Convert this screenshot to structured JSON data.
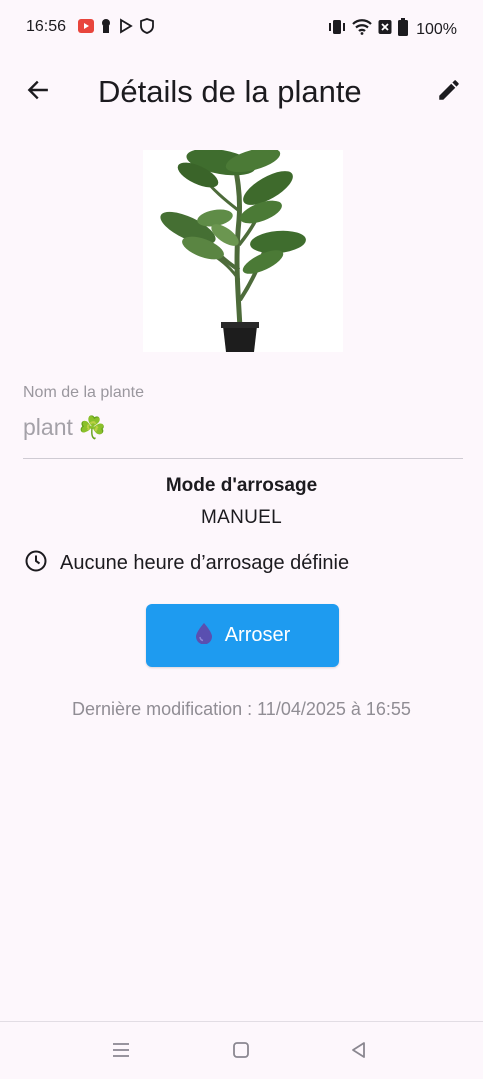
{
  "status_bar": {
    "time": "16:56",
    "battery": "100%",
    "left_icons": [
      "youtube-icon",
      "notification-icon",
      "play-store-icon",
      "shield-icon"
    ],
    "right_icons": [
      "vibrate-icon",
      "wifi-icon",
      "no-sim-icon",
      "battery-icon"
    ]
  },
  "app_bar": {
    "title": "Détails de la plante",
    "back_icon": "arrow-back-icon",
    "edit_icon": "pencil-icon"
  },
  "plant": {
    "name_label": "Nom de la plante",
    "name_value": "plant",
    "name_emoji": "☘️"
  },
  "watering": {
    "mode_title": "Mode d'arrosage",
    "mode_value": "MANUEL",
    "schedule_icon": "clock-icon",
    "schedule_text": "Aucune heure d’arrosage définie",
    "button_label": "Arroser",
    "button_icon": "water-drop-icon",
    "button_color": "#1e9bf0",
    "last_modified": "Dernière modification : 11/04/2025 à 16:55"
  },
  "nav_bar": {
    "icons": [
      "menu-icon",
      "home-icon",
      "back-icon"
    ]
  }
}
